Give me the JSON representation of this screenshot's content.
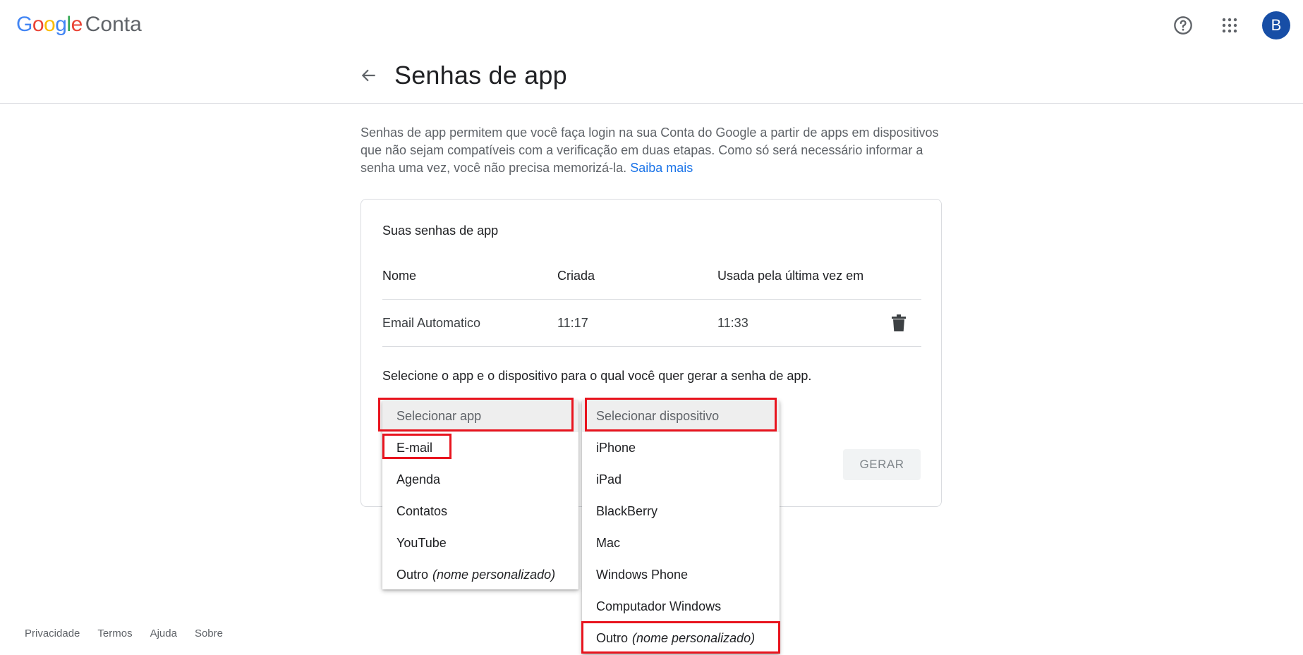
{
  "header": {
    "logo_letters": [
      {
        "ch": "G",
        "color": "#4285F4"
      },
      {
        "ch": "o",
        "color": "#EA4335"
      },
      {
        "ch": "o",
        "color": "#FBBC05"
      },
      {
        "ch": "g",
        "color": "#4285F4"
      },
      {
        "ch": "l",
        "color": "#34A853"
      },
      {
        "ch": "e",
        "color": "#EA4335"
      }
    ],
    "product": "Conta",
    "avatar_initial": "B",
    "icons": [
      "help-icon",
      "apps-grid-icon"
    ]
  },
  "page": {
    "title": "Senhas de app",
    "description": "Senhas de app permitem que você faça login na sua Conta do Google a partir de apps em dispositivos que não sejam compatíveis com a verificação em duas etapas. Como só será necessário informar a senha uma vez, você não precisa memorizá-la.",
    "learn_more": "Saiba mais"
  },
  "card": {
    "title": "Suas senhas de app",
    "columns": [
      "Nome",
      "Criada",
      "Usada pela última vez em"
    ],
    "rows": [
      {
        "name": "Email Automatico",
        "created": "11:17",
        "last_used": "11:33"
      }
    ],
    "instruction": "Selecione o app e o dispositivo para o qual você quer gerar a senha de app.",
    "generate_label": "GERAR"
  },
  "app_menu": {
    "placeholder": "Selecionar app",
    "items": [
      "E-mail",
      "Agenda",
      "Contatos",
      "YouTube"
    ],
    "other_label": "Outro",
    "other_hint": "(nome personalizado)"
  },
  "device_menu": {
    "placeholder": "Selecionar dispositivo",
    "items": [
      "iPhone",
      "iPad",
      "BlackBerry",
      "Mac",
      "Windows Phone",
      "Computador Windows"
    ],
    "other_label": "Outro",
    "other_hint": "(nome personalizado)"
  },
  "footer": {
    "links": [
      "Privacidade",
      "Termos",
      "Ajuda",
      "Sobre"
    ]
  },
  "colors": {
    "accent": "#1a73e8",
    "highlight": "#e8141e",
    "avatar_bg": "#174ea6"
  }
}
